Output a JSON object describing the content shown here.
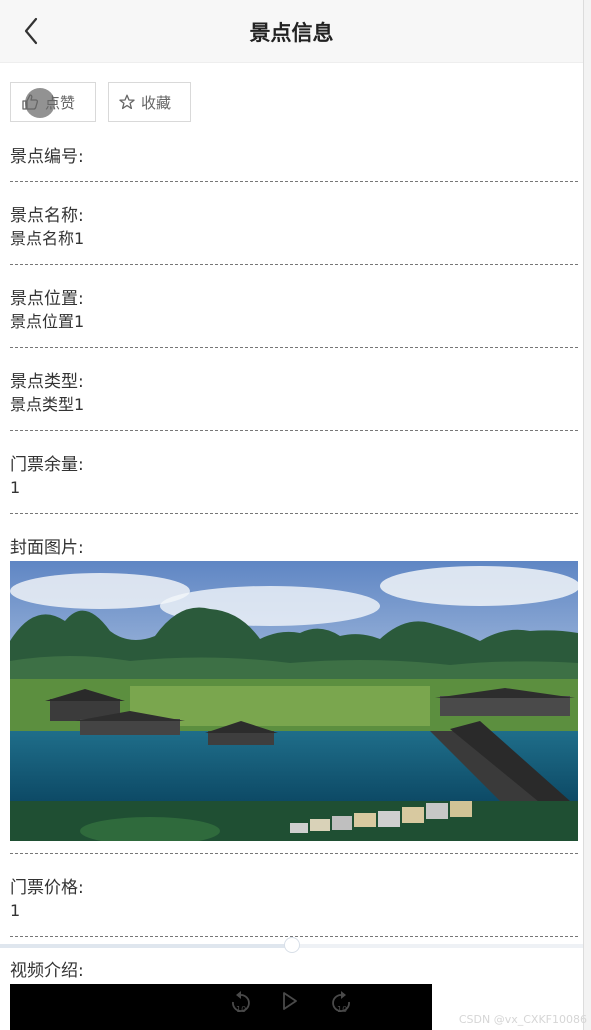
{
  "header": {
    "title": "景点信息",
    "back_icon": "chevron-left-icon"
  },
  "actions": {
    "like_label": "点赞",
    "like_icon": "thumbs-up-icon",
    "favorite_label": "收藏",
    "favorite_icon": "star-outline-icon"
  },
  "fields": [
    {
      "label": "景点编号:",
      "value": ""
    },
    {
      "label": "景点名称:",
      "value": "景点名称1"
    },
    {
      "label": "景点位置:",
      "value": "景点位置1"
    },
    {
      "label": "景点类型:",
      "value": "景点类型1"
    },
    {
      "label": "门票余量:",
      "value": "1"
    },
    {
      "label": "封面图片:",
      "value": ""
    },
    {
      "label": "门票价格:",
      "value": "1"
    },
    {
      "label": "视频介绍:",
      "value": ""
    }
  ],
  "progress": {
    "fraction": 0.5
  },
  "video": {
    "rewind_label": "10",
    "forward_label": "10",
    "rewind_icon": "rewind-10-icon",
    "play_icon": "play-icon",
    "forward_icon": "forward-10-icon"
  },
  "watermark": "CSDN @vx_CXKF10086"
}
